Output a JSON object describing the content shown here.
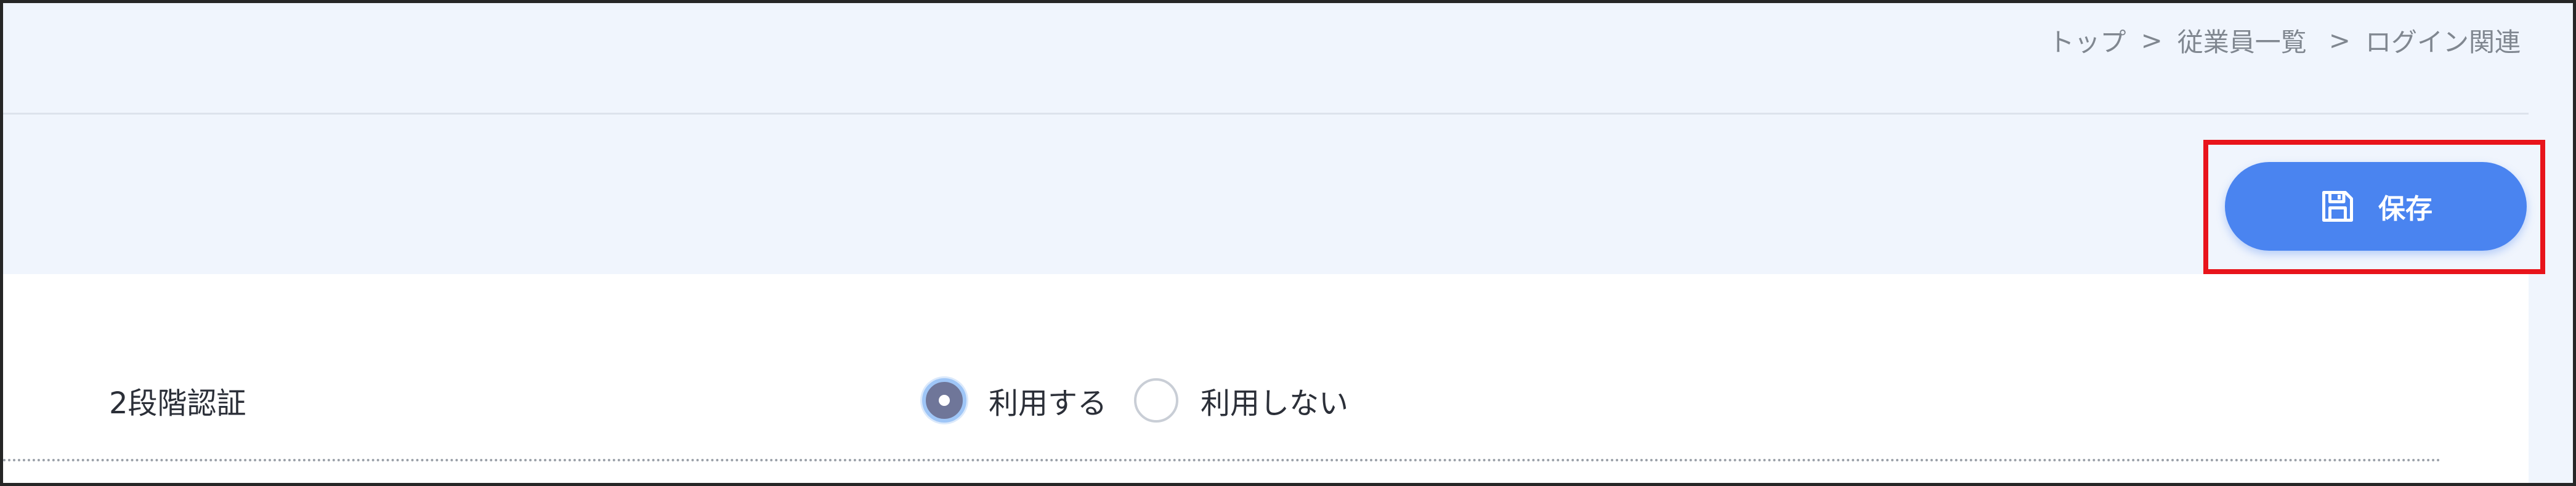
{
  "breadcrumb": {
    "items": [
      "トップ",
      "従業員一覧",
      "ログイン関連"
    ],
    "separator": ">"
  },
  "toolbar": {
    "save_label": "保存",
    "save_icon": "floppy-disk-icon"
  },
  "settings": {
    "two_factor": {
      "label": "2段階認証",
      "options": [
        {
          "label": "利用する",
          "selected": true
        },
        {
          "label": "利用しない",
          "selected": false
        }
      ]
    }
  },
  "colors": {
    "accent": "#4a84f0",
    "highlight": "#e8141b",
    "background": "#f0f5fd"
  }
}
